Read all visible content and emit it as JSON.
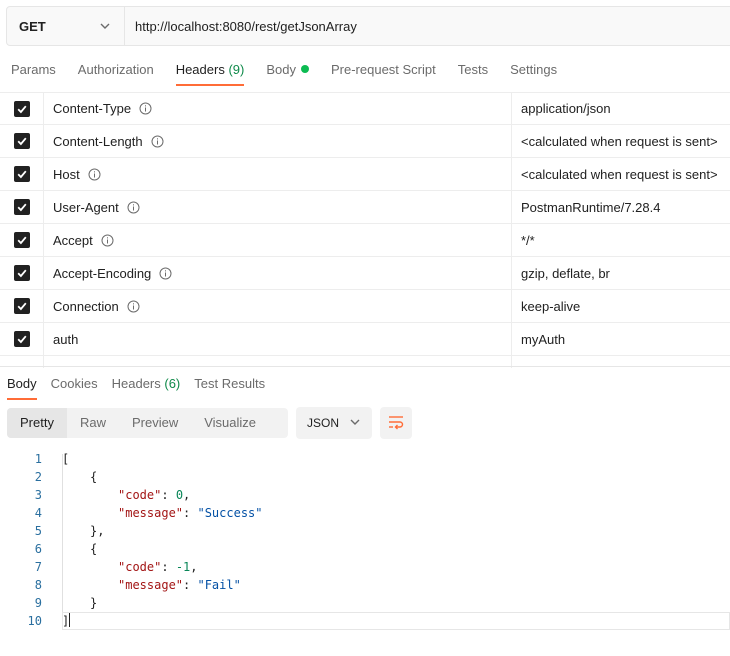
{
  "request": {
    "method": "GET",
    "url": "http://localhost:8080/rest/getJsonArray"
  },
  "request_tabs": [
    {
      "label": "Params"
    },
    {
      "label": "Authorization"
    },
    {
      "label": "Headers",
      "count": "(9)",
      "active": true
    },
    {
      "label": "Body",
      "dot": true
    },
    {
      "label": "Pre-request Script"
    },
    {
      "label": "Tests"
    },
    {
      "label": "Settings"
    }
  ],
  "headers": [
    {
      "key": "Content-Type",
      "value": "application/json",
      "info": true
    },
    {
      "key": "Content-Length",
      "value": "<calculated when request is sent>",
      "info": true
    },
    {
      "key": "Host",
      "value": "<calculated when request is sent>",
      "info": true
    },
    {
      "key": "User-Agent",
      "value": "PostmanRuntime/7.28.4",
      "info": true
    },
    {
      "key": "Accept",
      "value": "*/*",
      "info": true
    },
    {
      "key": "Accept-Encoding",
      "value": "gzip, deflate, br",
      "info": true
    },
    {
      "key": "Connection",
      "value": "keep-alive",
      "info": true
    },
    {
      "key": "auth",
      "value": "myAuth",
      "info": false
    }
  ],
  "response_tabs": [
    {
      "label": "Body",
      "active": true
    },
    {
      "label": "Cookies"
    },
    {
      "label": "Headers",
      "count": "(6)"
    },
    {
      "label": "Test Results"
    }
  ],
  "view_modes": [
    "Pretty",
    "Raw",
    "Preview",
    "Visualize"
  ],
  "active_view_mode": "Pretty",
  "format": "JSON",
  "code_lines": [
    {
      "n": "1",
      "indent": 0,
      "tokens": [
        [
          "p",
          "["
        ]
      ]
    },
    {
      "n": "2",
      "indent": 1,
      "tokens": [
        [
          "p",
          "{"
        ]
      ]
    },
    {
      "n": "3",
      "indent": 2,
      "tokens": [
        [
          "k",
          "\"code\""
        ],
        [
          "p",
          ": "
        ],
        [
          "n",
          "0"
        ],
        [
          "p",
          ","
        ]
      ]
    },
    {
      "n": "4",
      "indent": 2,
      "tokens": [
        [
          "k",
          "\"message\""
        ],
        [
          "p",
          ": "
        ],
        [
          "s",
          "\"Success\""
        ]
      ]
    },
    {
      "n": "5",
      "indent": 1,
      "tokens": [
        [
          "p",
          "},"
        ]
      ]
    },
    {
      "n": "6",
      "indent": 1,
      "tokens": [
        [
          "p",
          "{"
        ]
      ]
    },
    {
      "n": "7",
      "indent": 2,
      "tokens": [
        [
          "k",
          "\"code\""
        ],
        [
          "p",
          ": "
        ],
        [
          "n",
          "-1"
        ],
        [
          "p",
          ","
        ]
      ]
    },
    {
      "n": "8",
      "indent": 2,
      "tokens": [
        [
          "k",
          "\"message\""
        ],
        [
          "p",
          ": "
        ],
        [
          "s",
          "\"Fail\""
        ]
      ]
    },
    {
      "n": "9",
      "indent": 1,
      "tokens": [
        [
          "p",
          "}"
        ]
      ]
    },
    {
      "n": "10",
      "indent": 0,
      "tokens": [
        [
          "p",
          "]"
        ]
      ],
      "cursor": true
    }
  ],
  "colors": {
    "accent": "#ff6c37",
    "count_green": "#0f8a4a",
    "dot_green": "#0cbb52",
    "json_key": "#a31515",
    "json_string": "#0451a5",
    "json_number": "#098658",
    "line_number": "#2a6f9f"
  }
}
